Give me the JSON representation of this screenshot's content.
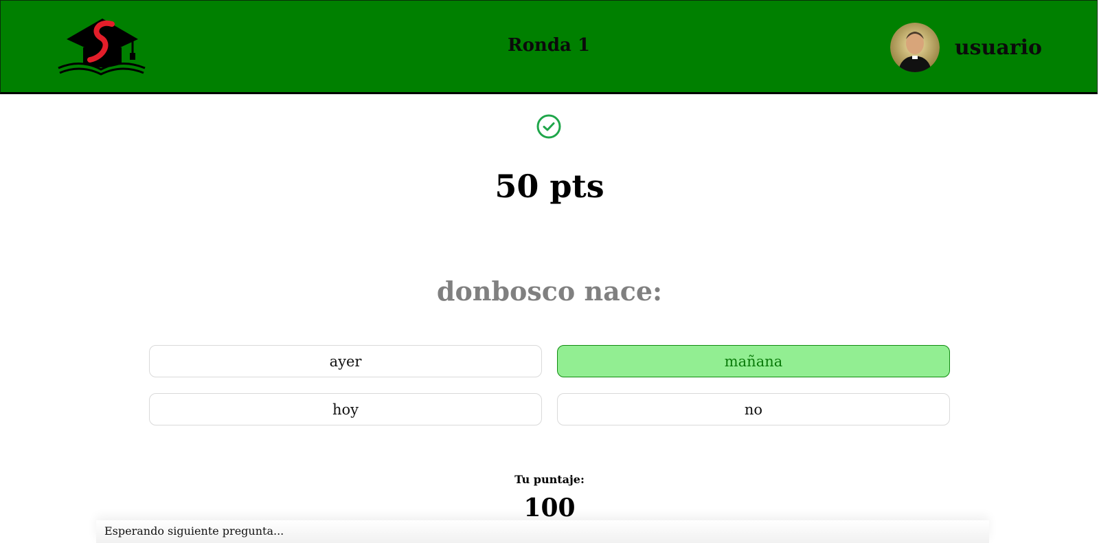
{
  "header": {
    "round_title": "Ronda 1",
    "username": "usuario",
    "background_color": "#008000"
  },
  "result": {
    "icon": "check-circle-icon",
    "points": "50 pts",
    "color": "#1fa64a"
  },
  "question": {
    "text": "donbosco nace:"
  },
  "answers": [
    {
      "label": "ayer",
      "selected": false
    },
    {
      "label": "mañana",
      "selected": true
    },
    {
      "label": "hoy",
      "selected": false
    },
    {
      "label": "no",
      "selected": false
    }
  ],
  "score": {
    "label": "Tu puntaje:",
    "value": "100"
  },
  "status": {
    "text": "Esperando siguiente pregunta..."
  }
}
